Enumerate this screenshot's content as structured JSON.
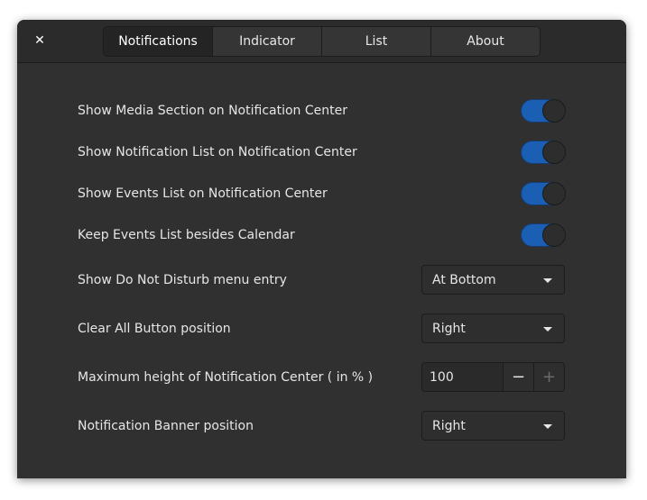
{
  "header": {
    "close_glyph": "✕",
    "tabs": [
      {
        "label": "Notifications",
        "active": true
      },
      {
        "label": "Indicator",
        "active": false
      },
      {
        "label": "List",
        "active": false
      },
      {
        "label": "About",
        "active": false
      }
    ]
  },
  "settings": {
    "show_media": {
      "label": "Show Media Section on Notification Center",
      "enabled": true
    },
    "show_notification_list": {
      "label": "Show Notification List on Notification Center",
      "enabled": true
    },
    "show_events_list": {
      "label": "Show Events List on Notification Center",
      "enabled": true
    },
    "keep_events_list": {
      "label": "Keep Events List besides Calendar",
      "enabled": true
    },
    "dnd_menu_entry": {
      "label": "Show Do Not Disturb menu entry",
      "value": "At Bottom"
    },
    "clear_all_position": {
      "label": "Clear All Button position",
      "value": "Right"
    },
    "max_height": {
      "label": "Maximum height of Notification Center ( in % )",
      "value": "100",
      "minus": "−",
      "plus": "+"
    },
    "banner_position": {
      "label": "Notification Banner position",
      "value": "Right"
    }
  },
  "colors": {
    "switch_on": "#1b5fb5",
    "window_bg": "#303030",
    "headerbar_bg": "#2b2b2b"
  }
}
